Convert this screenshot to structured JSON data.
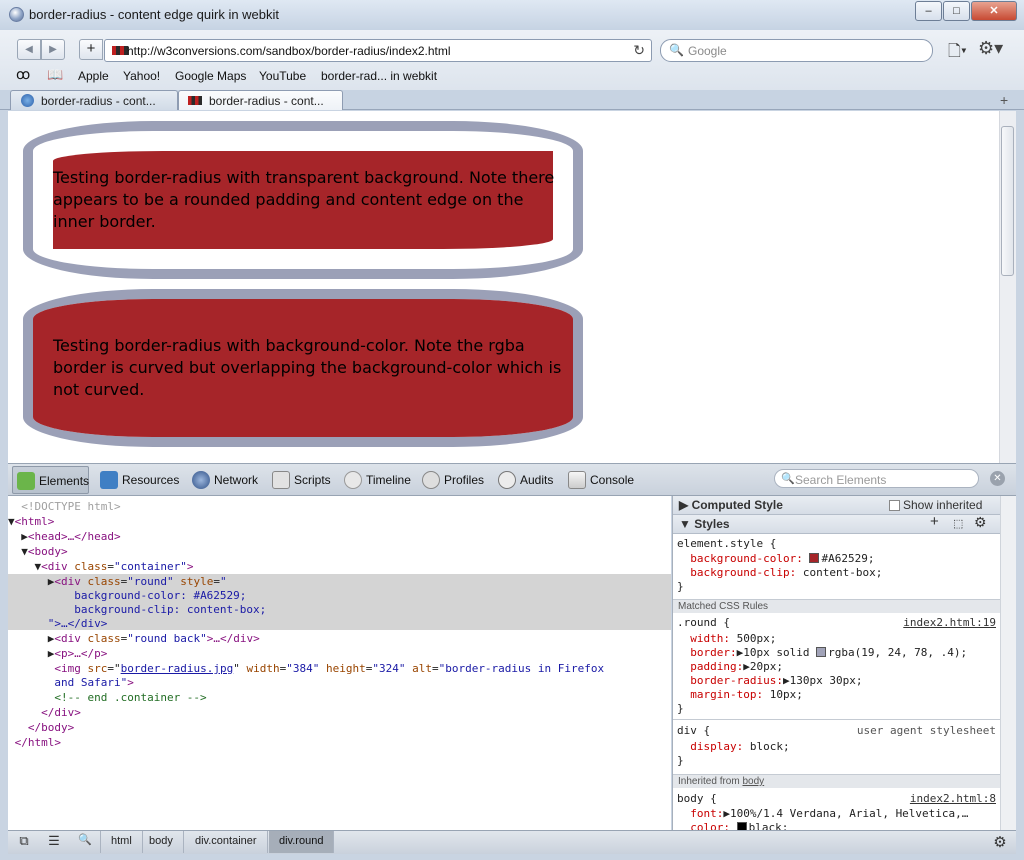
{
  "window": {
    "title": "border-radius - content edge quirk in webkit",
    "minimize": "–",
    "maximize": "□",
    "close": "✕"
  },
  "toolbar": {
    "back": "◀",
    "forward": "▶",
    "add": "+",
    "url": "http://w3conversions.com/sandbox/border-radius/index2.html",
    "search_placeholder": "Google",
    "reload": "↻",
    "page_menu": "🗋▾",
    "settings": "⚙▾"
  },
  "bookmarks": {
    "reader": "ꝏ",
    "book": "📖",
    "items": [
      "Apple",
      "Yahoo!",
      "Google Maps",
      "YouTube",
      "border-rad... in webkit"
    ]
  },
  "tabs": [
    {
      "label": "border-radius - cont..."
    },
    {
      "label": "border-radius - cont..."
    }
  ],
  "tab_add": "+",
  "page": {
    "box1_text": "Testing border-radius with transparent background. Note there appears to be a rounded padding and content edge on the inner border.",
    "box2_text": "Testing border-radius with background-color. Note the rgba border is curved but overlapping the background-color which is not curved.",
    "fill_color": "#a62529",
    "border_color": "rgba(19, 24, 78, .4)"
  },
  "devtools": {
    "tabs": [
      "Elements",
      "Resources",
      "Network",
      "Scripts",
      "Timeline",
      "Profiles",
      "Audits",
      "Console"
    ],
    "search_placeholder": "Search Elements",
    "close": "✕",
    "dom": {
      "doctype": "<!DOCTYPE html>",
      "html_open": "<html>",
      "head": "<head>…</head>",
      "body_open": "<body>",
      "container_open_tag": "<div",
      "container_attr": "class",
      "container_val": "\"container\"",
      "round_tag": "<div",
      "round_attr1": "class",
      "round_val1": "\"round\"",
      "round_attr2": "style",
      "round_val2_open": "\"",
      "round_style1": "background-color: #A62529;",
      "round_style2": "background-clip: content-box;",
      "round_close": "\">…</div>",
      "roundback_tag": "<div",
      "roundback_attr": "class",
      "roundback_val": "\"round back\"",
      "roundback_close": ">…</div>",
      "p": "<p>…</p>",
      "img_tag": "<img",
      "img_src_attr": "src",
      "img_src": "border-radius.jpg",
      "img_w_attr": "width",
      "img_w": "\"384\"",
      "img_h_attr": "height",
      "img_h": "\"324\"",
      "img_alt_attr": "alt",
      "img_alt1": "\"border-radius in Firefox",
      "img_alt2": "and Safari\"",
      "img_end": ">",
      "comment": "<!-- end .container -->",
      "div_close": "</div>",
      "body_close": "</body>",
      "html_close": "</html>"
    },
    "styles": {
      "computed_header": "Computed Style",
      "show_inherited": "Show inherited",
      "styles_header": "Styles",
      "element_style": "element.style {",
      "es_p1": "background-color:",
      "es_v1": "#A62529;",
      "es_p2": "background-clip:",
      "es_v2": "content-box;",
      "close_brace": "}",
      "matched_header": "Matched CSS Rules",
      "round_sel": ".round {",
      "round_src": "index2.html:19",
      "r_p1": "width:",
      "r_v1": "500px;",
      "r_p2": "border:",
      "r_v2a": "10px solid",
      "r_v2b": "rgba(19, 24, 78, .4);",
      "r_p3": "padding:",
      "r_v3": "20px;",
      "r_p4": "border-radius:",
      "r_v4": "130px 30px;",
      "r_p5": "margin-top:",
      "r_v5": "10px;",
      "div_sel": "div {",
      "div_src": "user agent stylesheet",
      "d_p1": "display:",
      "d_v1": "block;",
      "inherited_label": "Inherited from",
      "inherited_link": "body",
      "body_sel": "body {",
      "body_src": "index2.html:8",
      "b_p1": "font:",
      "b_v1": "100%/1.4 Verdana, Arial, Helvetica,…",
      "b_p2": "color:",
      "b_v2": "black;"
    },
    "breadcrumbs": [
      "html",
      "body",
      "div.container",
      "div.round"
    ],
    "status_icons": {
      "dock": "⧉",
      "console": "☰",
      "search": "🔍",
      "settings": "⚙"
    }
  }
}
